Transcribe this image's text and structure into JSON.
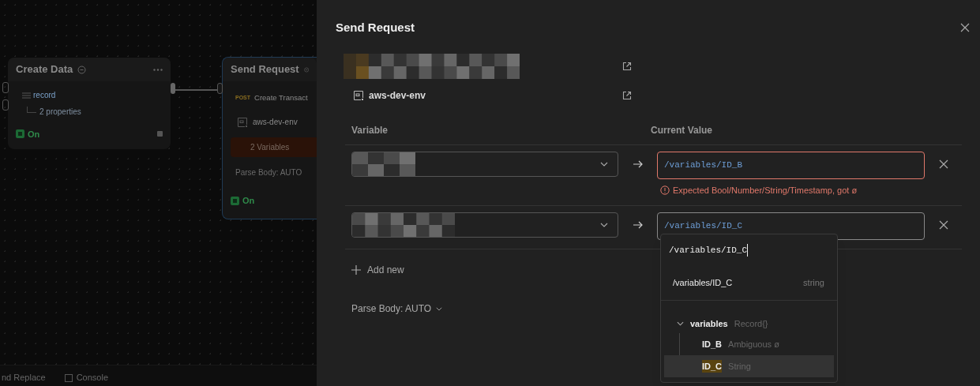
{
  "canvas": {
    "nodes": [
      {
        "kind": "data",
        "title": "Create Data",
        "field": "record",
        "detail": "2 properties",
        "status": "On",
        "on": true
      },
      {
        "kind": "request",
        "title": "Send Request",
        "method": "POST",
        "request": "Create Transact",
        "environment": "aws-dev-env",
        "badge": "2 Variables",
        "parse_body": "Parse Body: AUTO",
        "status": "On",
        "on": true
      }
    ]
  },
  "bottom_bar": [
    {
      "label": "nd Replace"
    },
    {
      "label": "Console"
    }
  ],
  "panel": {
    "title": "Send Request",
    "environment": "aws-dev-env",
    "columns": [
      "Variable",
      "Current Value"
    ],
    "rows": [
      {
        "value": "/variables/ID_B",
        "error": "Expected Bool/Number/String/Timestamp, got ø"
      },
      {
        "value": "/variables/ID_C"
      }
    ],
    "add_label": "Add new",
    "parse_body": "Parse Body: AUTO",
    "dropdown": {
      "query": "/variables/ID_C",
      "suggestion": {
        "path": "/variables/ID_C",
        "type": "string"
      },
      "tree": {
        "label": "variables",
        "type": "Record{}",
        "expanded": true,
        "children": [
          {
            "label": "ID_B",
            "type": "Ambiguous ø",
            "selected": false
          },
          {
            "label": "ID_C",
            "type": "String",
            "selected": true
          }
        ]
      }
    }
  }
}
